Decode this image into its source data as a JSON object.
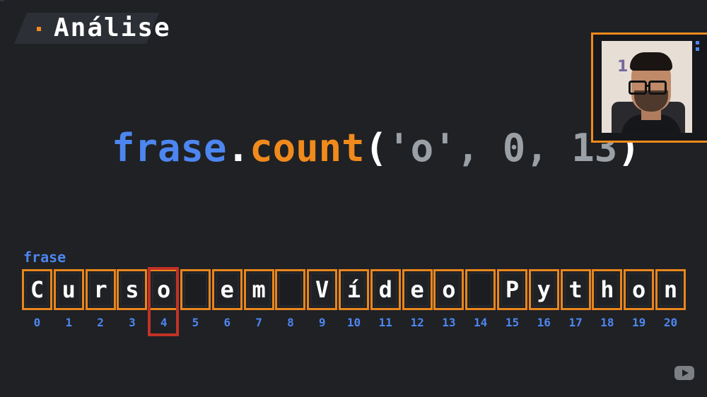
{
  "title": "Análise",
  "code": {
    "var": "frase",
    "dot": ".",
    "method": "count",
    "open_paren": "(",
    "args": "'o', 0, 13",
    "close_paren": ")"
  },
  "variable_label": "frase",
  "string_chars": [
    "C",
    "u",
    "r",
    "s",
    "o",
    " ",
    "e",
    "m",
    " ",
    "V",
    "í",
    "d",
    "e",
    "o",
    " ",
    "P",
    "y",
    "t",
    "h",
    "o",
    "n"
  ],
  "indices": [
    "0",
    "1",
    "2",
    "3",
    "4",
    "5",
    "6",
    "7",
    "8",
    "9",
    "10",
    "11",
    "12",
    "13",
    "14",
    "15",
    "16",
    "17",
    "18",
    "19",
    "20"
  ],
  "highlighted_index": 4,
  "colors": {
    "background": "#1f2125",
    "accent_orange": "#f08a1c",
    "accent_blue": "#4d86f0",
    "highlight_red": "#c23225"
  },
  "icons": [
    "youtube-icon"
  ],
  "webcam": {
    "background_text": "1 et"
  }
}
